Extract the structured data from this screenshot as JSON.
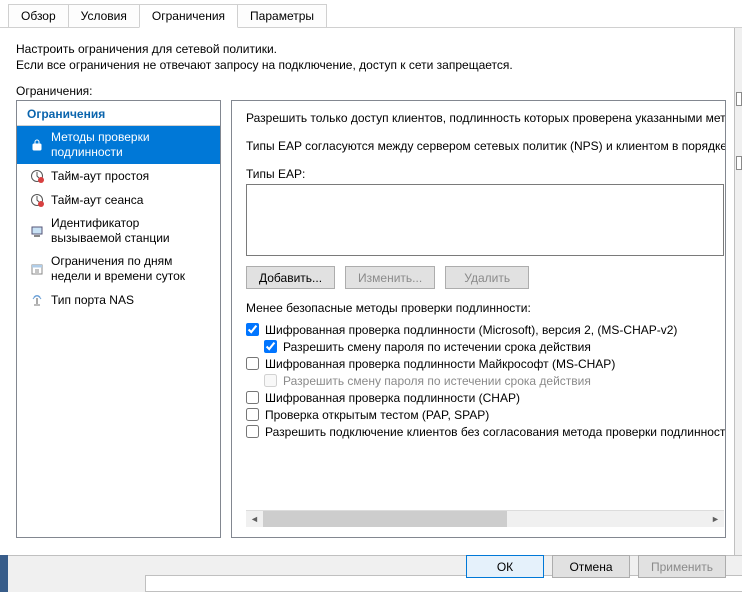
{
  "tabs": [
    "Обзор",
    "Условия",
    "Ограничения",
    "Параметры"
  ],
  "active_tab": 2,
  "desc1": "Настроить ограничения для сетевой политики.",
  "desc2": "Если все ограничения не отвечают запросу на подключение, доступ к сети запрещается.",
  "left_title": "Ограничения:",
  "group_header": "Ограничения",
  "tree": [
    {
      "label": "Методы проверки подлинности",
      "selected": true,
      "icon": "lock-icon"
    },
    {
      "label": "Тайм-аут простоя",
      "selected": false,
      "icon": "clock-red-icon"
    },
    {
      "label": "Тайм-аут сеанса",
      "selected": false,
      "icon": "clock-red-icon"
    },
    {
      "label": "Идентификатор вызываемой станции",
      "selected": false,
      "icon": "station-icon"
    },
    {
      "label": "Ограничения по дням недели и времени суток",
      "selected": false,
      "icon": "calendar-icon"
    },
    {
      "label": "Тип порта NAS",
      "selected": false,
      "icon": "antenna-icon"
    }
  ],
  "rp": {
    "line1": "Разрешить только доступ клиентов, подлинность которых проверена указанными мет",
    "line2": "Типы EAP согласуются между сервером сетевых политик (NPS) и клиентом в порядке",
    "eap_label": "Типы EAP:",
    "buttons": {
      "add": "Добавить...",
      "edit": "Изменить...",
      "delete": "Удалить"
    },
    "less_secure_header": "Менее безопасные методы проверки подлинности:",
    "checks": [
      {
        "label": "Шифрованная проверка подлинности (Microsoft), версия 2, (MS-CHAP-v2)",
        "checked": true,
        "indent": false,
        "disabled": false
      },
      {
        "label": "Разрешить смену пароля по истечении срока действия",
        "checked": true,
        "indent": true,
        "disabled": false
      },
      {
        "label": "Шифрованная проверка подлинности Майкрософт (MS-CHAP)",
        "checked": false,
        "indent": false,
        "disabled": false
      },
      {
        "label": "Разрешить смену пароля по истечении срока действия",
        "checked": false,
        "indent": true,
        "disabled": true
      },
      {
        "label": "Шифрованная проверка подлинности (CHAP)",
        "checked": false,
        "indent": false,
        "disabled": false
      },
      {
        "label": "Проверка открытым тестом (PAP, SPAP)",
        "checked": false,
        "indent": false,
        "disabled": false
      },
      {
        "label": "Разрешить подключение клиентов без согласования метода проверки подлинност",
        "checked": false,
        "indent": false,
        "disabled": false
      }
    ]
  },
  "dialog_buttons": {
    "ok": "ОК",
    "cancel": "Отмена",
    "apply": "Применить"
  }
}
